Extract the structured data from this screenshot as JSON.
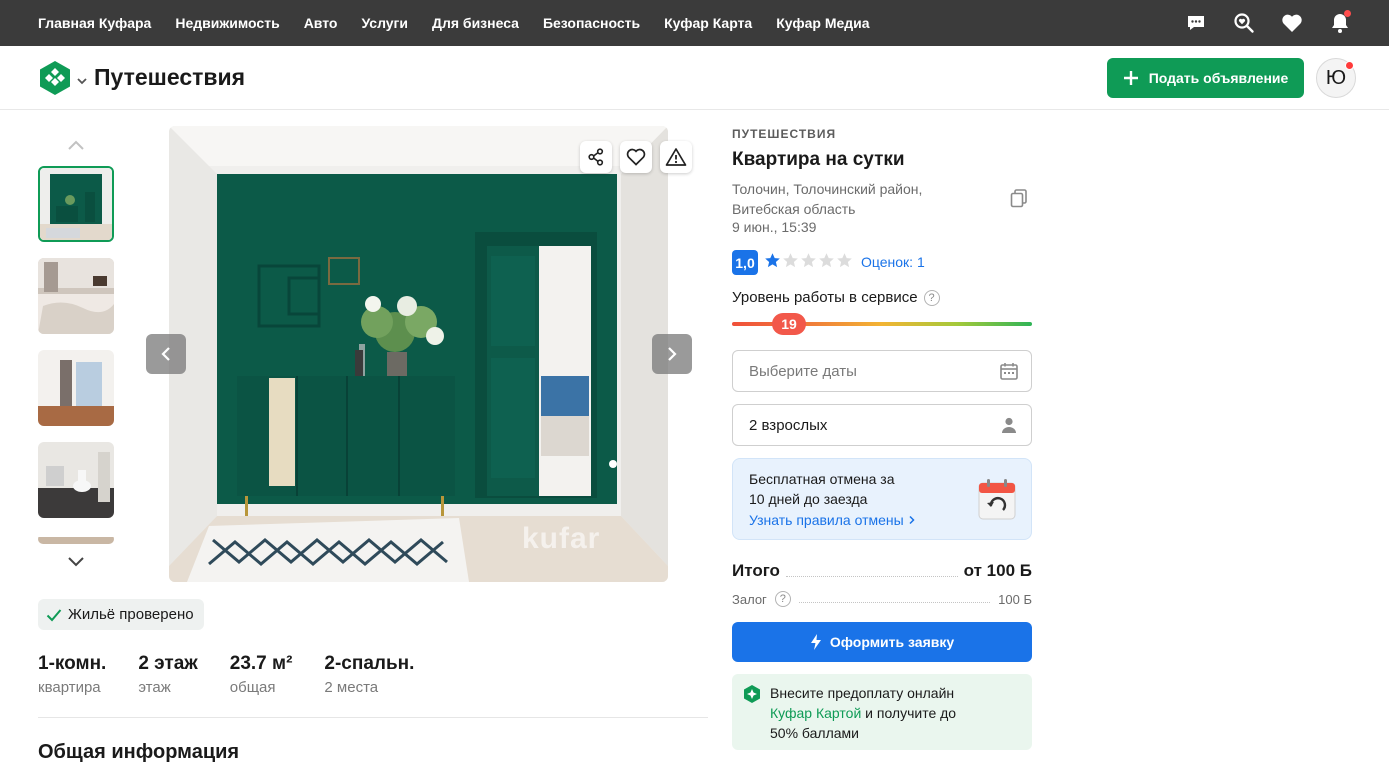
{
  "topnav": {
    "links": [
      "Главная Куфара",
      "Недвижимость",
      "Авто",
      "Услуги",
      "Для бизнеса",
      "Безопасность",
      "Куфар Карта",
      "Куфар Медиа"
    ],
    "icons": [
      "chat-icon",
      "search-heart-icon",
      "heart-icon",
      "bell-icon"
    ]
  },
  "header": {
    "section_title": "Путешествия",
    "post_button": "Подать объявление",
    "avatar_letter": "Ю"
  },
  "gallery": {
    "watermark": "kufar",
    "thumbnail_count_visible": 5
  },
  "listing": {
    "verified": "Жильё проверено",
    "facts": [
      {
        "value": "1-комн.",
        "label": "квартира"
      },
      {
        "value": "2 этаж",
        "label": "этаж"
      },
      {
        "value": "23.7 м²",
        "label": "общая"
      },
      {
        "value": "2-спальн.",
        "label": "2 места"
      }
    ],
    "general_heading": "Общая информация"
  },
  "sidebar": {
    "category": "ПУТЕШЕСТВИЯ",
    "title": "Квартира на сутки",
    "location_line1": "Толочин, Толочинский район,",
    "location_line2": "Витебская область",
    "date": "9 июн., 15:39",
    "rating": "1,0",
    "stars_filled": 1,
    "stars_total": 5,
    "reviews": "Оценок: 1",
    "service_label": "Уровень работы в сервисе",
    "service_level": "19",
    "dates_placeholder": "Выберите даты",
    "guests_value": "2 взрослых",
    "cancel_line1": "Бесплатная отмена за",
    "cancel_line2": "10 дней до заезда",
    "cancel_link": "Узнать правила отмены",
    "total_label": "Итого",
    "total_value": "от 100 Б",
    "deposit_label": "Залог",
    "deposit_value": "100 Б",
    "apply_button": "Оформить заявку",
    "promo_part1": "Внесите предоплату онлайн",
    "promo_link": "Куфар Картой",
    "promo_part2": " и получите до",
    "promo_part3": "50% баллами"
  },
  "colors": {
    "brand_green": "#0f9b56",
    "accent_blue": "#1a73e8",
    "topnav_bg": "#3b3b3b",
    "room_green": "#0c5a48"
  }
}
